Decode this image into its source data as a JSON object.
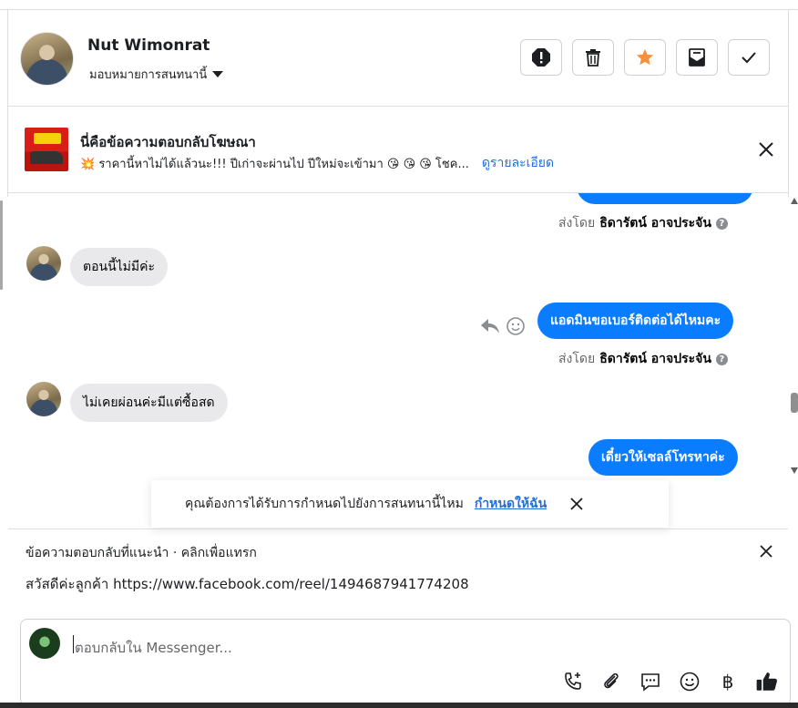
{
  "header": {
    "name": "Nut Wimonrat",
    "assign_label": "มอบหมายการสนทนานี้",
    "toolbar_icons": [
      "alert-icon",
      "trash-icon",
      "star-icon",
      "mark-unread-icon",
      "check-icon"
    ],
    "star_color": "#f7923b"
  },
  "ad_reply": {
    "title": "นี่คือข้อความตอบกลับโฆษณา",
    "preview": "💥 ราคานี้หาไม่ได้แล้วนะ!!! ปีเก่าจะผ่านไป ปีใหม่จะเข้ามา 😘 😘 😘 โชค...",
    "details_link": "ดูรายละเอียด"
  },
  "conversation": {
    "sent_by_prefix": "ส่งโดย",
    "agent_name": "ธิดารัตน์ อาจประจัน",
    "messages": [
      {
        "from": "customer",
        "text": "ตอนนี้ไม่มีค่ะ"
      },
      {
        "from": "page",
        "text": "แอดมินขอเบอร์ติดต่อได้ไหมคะ"
      },
      {
        "from": "customer",
        "text": "ไม่เคยผ่อนค่ะมีแต่ซื้อสด"
      },
      {
        "from": "page",
        "text": "เดี๋ยวให้เซลล์โทรหาค่ะ"
      }
    ]
  },
  "assign_prompt": {
    "text": "คุณต้องการได้รับการกำหนดไปยังการสนทนานี้ไหม",
    "link": "กำหนดให้ฉัน"
  },
  "suggested_reply": {
    "header": "ข้อความตอบกลับที่แนะนำ · คลิกเพื่อแทรก",
    "text": "สวัสดีค่ะลูกค้า https://www.facebook.com/reel/1494687941774208"
  },
  "composer": {
    "placeholder": "ตอบกลับใน Messenger...",
    "icons": [
      "call-icon",
      "attach-icon",
      "saved-reply-icon",
      "emoji-icon",
      "baht-icon",
      "like-icon"
    ]
  },
  "colors": {
    "accent": "#0a7cff",
    "link": "#216fdb",
    "bubble_in": "#e9e9ec"
  }
}
